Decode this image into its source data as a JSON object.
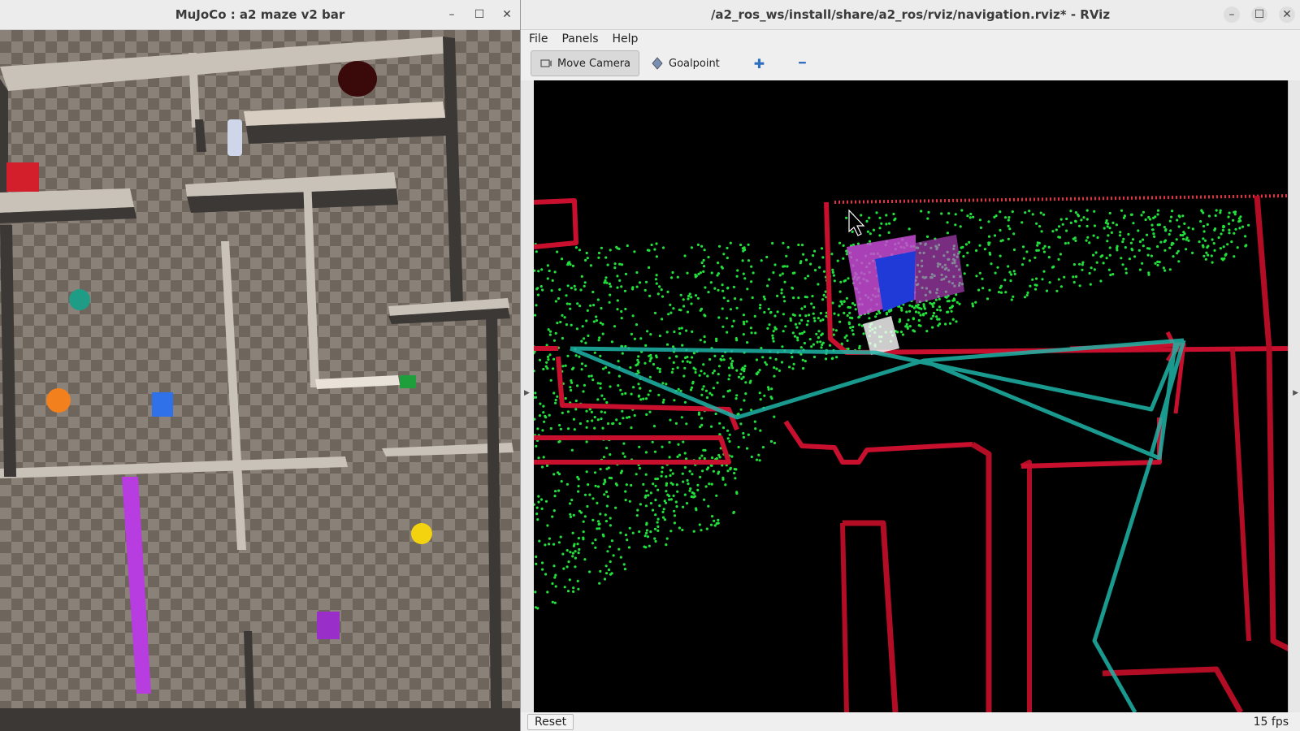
{
  "mujoco": {
    "title": "MuJoCo : a2 maze v2 bar",
    "controls": {
      "minimize": "–",
      "maximize": "☐",
      "close": "✕"
    }
  },
  "rviz": {
    "title": "/a2_ros_ws/install/share/a2_ros/rviz/navigation.rviz* - RViz",
    "controls": {
      "minimize": "–",
      "maximize": "☐",
      "close": "✕"
    },
    "menu": {
      "file": "File",
      "panels": "Panels",
      "help": "Help"
    },
    "toolbar": {
      "move_camera": "Move Camera",
      "goalpoint": "Goalpoint",
      "add_glyph": "✚",
      "remove_glyph": "━"
    },
    "status": {
      "reset_label": "Reset",
      "fps": "15 fps"
    }
  },
  "colors": {
    "laser_red": "#c8102e",
    "pointcloud_green": "#22e03c",
    "path_teal": "#1fb5a8",
    "robot_blue": "#1f3ad6",
    "robot_magenta": "#c84bd6"
  }
}
